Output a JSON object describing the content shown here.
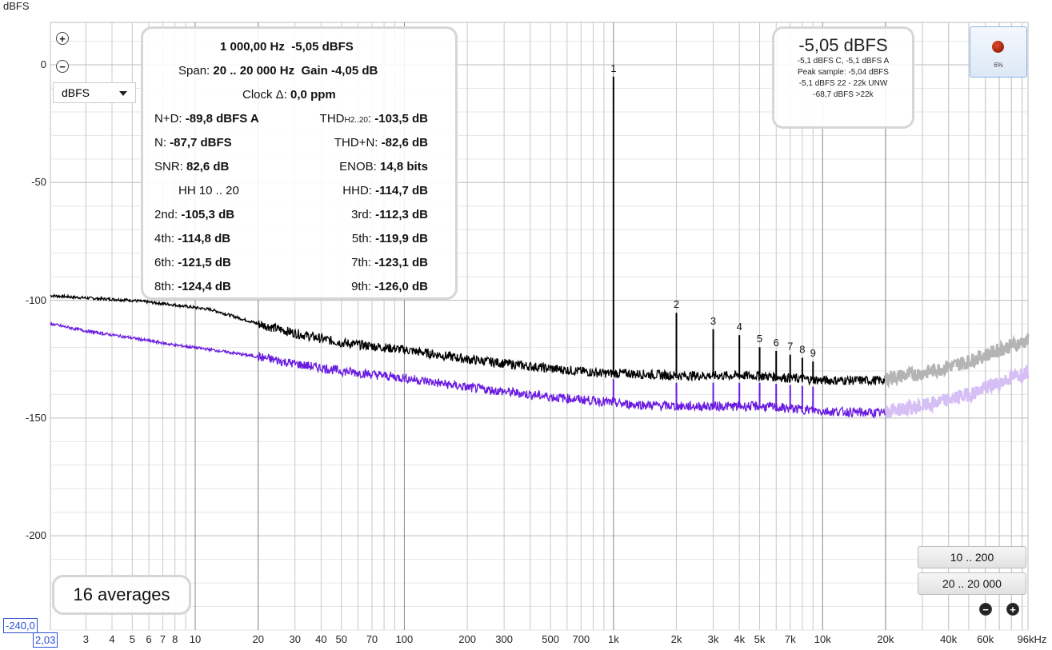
{
  "y_unit_label": "dBFS",
  "y_min_box": "-240,0",
  "x_min_box": "2,03",
  "stats": {
    "l1": {
      "a": "1 000,00 Hz",
      "b": "-5,05 dBFS"
    },
    "l2": {
      "a": "Span:",
      "b": "20 .. 20 000 Hz",
      "c": "Gain",
      "d": "-4,05 dB"
    },
    "l3": {
      "a": "Clock Δ:",
      "b": "0,0 ppm"
    },
    "rows": [
      {
        "l": "N+D:",
        "lv": "-89,8 dBFS A",
        "r": "THD",
        "rs": "H2..20",
        "rv": "-103,5 dB"
      },
      {
        "l": "N:",
        "lv": "-87,7 dBFS",
        "r": "THD+N:",
        "rs": "",
        "rv": "-82,6 dB"
      },
      {
        "l": "SNR:",
        "lv": "82,6 dB",
        "r": "ENOB:",
        "rs": "",
        "rv": "14,8 bits"
      },
      {
        "l": "HH 10 .. 20",
        "lv": "",
        "r": "HHD:",
        "rs": "",
        "rv": "-114,7 dB"
      },
      {
        "l": "2nd:",
        "lv": "-105,3 dB",
        "r": "3rd:",
        "rs": "",
        "rv": "-112,3 dB"
      },
      {
        "l": "4th:",
        "lv": "-114,8 dB",
        "r": "5th:",
        "rs": "",
        "rv": "-119,9 dB"
      },
      {
        "l": "6th:",
        "lv": "-121,5 dB",
        "r": "7th:",
        "rs": "",
        "rv": "-123,1 dB"
      },
      {
        "l": "8th:",
        "lv": "-124,4 dB",
        "r": "9th:",
        "rs": "",
        "rv": "-126,0 dB"
      }
    ]
  },
  "level": {
    "big": "-5,05 dBFS",
    "l1": "-5,1 dBFS C, -5,1 dBFS A",
    "l2": "Peak sample: -5,04 dBFS",
    "l3": "-5,1 dBFS 22 - 22k UNW",
    "l4": "-68,7 dBFS >22k"
  },
  "record": {
    "pct": "6%"
  },
  "averages": "16 averages",
  "select_value": "dBFS",
  "range_buttons": [
    "10 .. 200",
    "20 .. 20 000"
  ],
  "icons": {
    "zoom_in": "zoom-in-icon",
    "zoom_out": "zoom-out-icon",
    "record": "record-icon"
  },
  "colors": {
    "spectrum": "#000000",
    "noise": "#6a1be0",
    "out_of_band": "#b4b4b4",
    "noise_out_of_band": "#d6bff5",
    "grid": "#c8c8c8",
    "accent": "#2a4fd8"
  },
  "chart_data": {
    "type": "line",
    "x_scale": "log",
    "xlim": [
      2.03,
      96000
    ],
    "ylim": [
      -240,
      18
    ],
    "ylabel": "dBFS",
    "y_ticks": [
      0,
      -50,
      -100,
      -150,
      -200
    ],
    "x_tick_labels": [
      {
        "v": 3,
        "t": "3"
      },
      {
        "v": 4,
        "t": "4"
      },
      {
        "v": 5,
        "t": "5"
      },
      {
        "v": 6,
        "t": "6"
      },
      {
        "v": 7,
        "t": "7"
      },
      {
        "v": 8,
        "t": "8"
      },
      {
        "v": 10,
        "t": "10"
      },
      {
        "v": 20,
        "t": "20"
      },
      {
        "v": 30,
        "t": "30"
      },
      {
        "v": 40,
        "t": "40"
      },
      {
        "v": 50,
        "t": "50"
      },
      {
        "v": 70,
        "t": "70"
      },
      {
        "v": 100,
        "t": "100"
      },
      {
        "v": 200,
        "t": "200"
      },
      {
        "v": 300,
        "t": "300"
      },
      {
        "v": 500,
        "t": "500"
      },
      {
        "v": 700,
        "t": "700"
      },
      {
        "v": 1000,
        "t": "1k"
      },
      {
        "v": 2000,
        "t": "2k"
      },
      {
        "v": 3000,
        "t": "3k"
      },
      {
        "v": 4000,
        "t": "4k"
      },
      {
        "v": 5000,
        "t": "5k"
      },
      {
        "v": 7000,
        "t": "7k"
      },
      {
        "v": 10000,
        "t": "10k"
      },
      {
        "v": 20000,
        "t": "20k"
      },
      {
        "v": 40000,
        "t": "40k"
      },
      {
        "v": 60000,
        "t": "60k"
      },
      {
        "v": 96000,
        "t": "96kHz"
      }
    ],
    "series": [
      {
        "role": "spectrum",
        "x": [
          2.03,
          3,
          5,
          8,
          12,
          20,
          30,
          50,
          100,
          200,
          500,
          900,
          1100,
          2000,
          5000,
          10000,
          20000
        ],
        "y": [
          -98,
          -99,
          -100,
          -102,
          -104,
          -110,
          -114,
          -118,
          -121,
          -125,
          -129,
          -131,
          -131,
          -132,
          -132,
          -134,
          -134
        ]
      },
      {
        "role": "spectrum-out-of-band",
        "x": [
          20000,
          30000,
          50000,
          70000,
          96000
        ],
        "y": [
          -133,
          -131,
          -126,
          -121,
          -117
        ]
      },
      {
        "role": "noise",
        "x": [
          2.03,
          3,
          5,
          8,
          12,
          20,
          30,
          50,
          100,
          200,
          500,
          900,
          1100,
          2000,
          5000,
          10000,
          20000
        ],
        "y": [
          -110,
          -113,
          -116,
          -119,
          -121,
          -124,
          -127,
          -130,
          -133,
          -137,
          -141,
          -143,
          -144,
          -145,
          -145,
          -147,
          -148
        ]
      },
      {
        "role": "noise-out-of-band",
        "x": [
          20000,
          30000,
          50000,
          70000,
          96000
        ],
        "y": [
          -147,
          -145,
          -140,
          -135,
          -130
        ]
      }
    ],
    "peaks": [
      {
        "label": "1",
        "x": 1000,
        "y": -5.05
      },
      {
        "label": "2",
        "x": 2000,
        "y": -105.3
      },
      {
        "label": "3",
        "x": 3000,
        "y": -112.3
      },
      {
        "label": "4",
        "x": 4000,
        "y": -114.8
      },
      {
        "label": "5",
        "x": 5000,
        "y": -119.9
      },
      {
        "label": "6",
        "x": 6000,
        "y": -121.5
      },
      {
        "label": "7",
        "x": 7000,
        "y": -123.1
      },
      {
        "label": "8",
        "x": 8000,
        "y": -124.4
      },
      {
        "label": "9",
        "x": 9000,
        "y": -126.0
      }
    ]
  }
}
